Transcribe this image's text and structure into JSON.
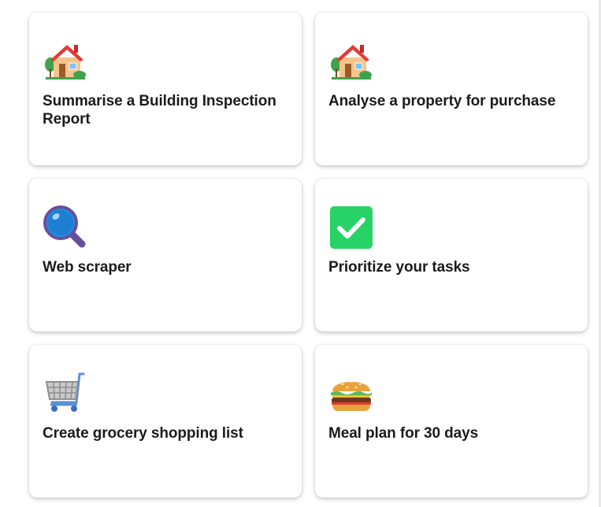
{
  "cards": [
    {
      "title": "Summarise a Building Inspection Report",
      "icon": "house-icon"
    },
    {
      "title": "Analyse a property for purchase",
      "icon": "house-icon"
    },
    {
      "title": "Web scraper",
      "icon": "magnifying-glass-icon"
    },
    {
      "title": "Prioritize your tasks",
      "icon": "check-mark-icon"
    },
    {
      "title": "Create grocery shopping list",
      "icon": "shopping-cart-icon"
    },
    {
      "title": "Meal plan for 30 days",
      "icon": "hamburger-icon"
    }
  ],
  "colors": {
    "title_text": "#1b1b1b",
    "check_green": "#27d366",
    "magnifier_blue": "#1a8fe0",
    "handle_purple": "#6a4e9e",
    "roof_red": "#e53935"
  }
}
